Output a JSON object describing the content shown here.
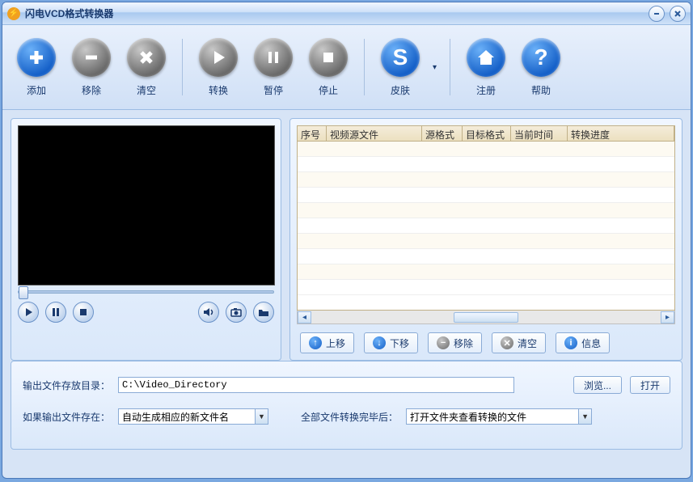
{
  "window": {
    "title": "闪电VCD格式转换器"
  },
  "toolbar": {
    "add": "添加",
    "remove": "移除",
    "clear": "清空",
    "convert": "转换",
    "pause": "暂停",
    "stop": "停止",
    "skin": "皮肤",
    "register": "注册",
    "help": "帮助"
  },
  "table": {
    "columns": {
      "index": "序号",
      "source_file": "视频源文件",
      "source_format": "源格式",
      "target_format": "目标格式",
      "current_time": "当前时间",
      "progress": "转换进度"
    },
    "rows": []
  },
  "list_actions": {
    "move_up": "上移",
    "move_down": "下移",
    "remove": "移除",
    "clear": "清空",
    "info": "信息"
  },
  "output": {
    "dir_label": "输出文件存放目录：",
    "dir_value": "C:\\Video_Directory",
    "browse": "浏览...",
    "open": "打开",
    "exists_label": "如果输出文件存在：",
    "exists_value": "自动生成相应的新文件名",
    "after_label": "全部文件转换完毕后：",
    "after_value": "打开文件夹查看转换的文件"
  }
}
